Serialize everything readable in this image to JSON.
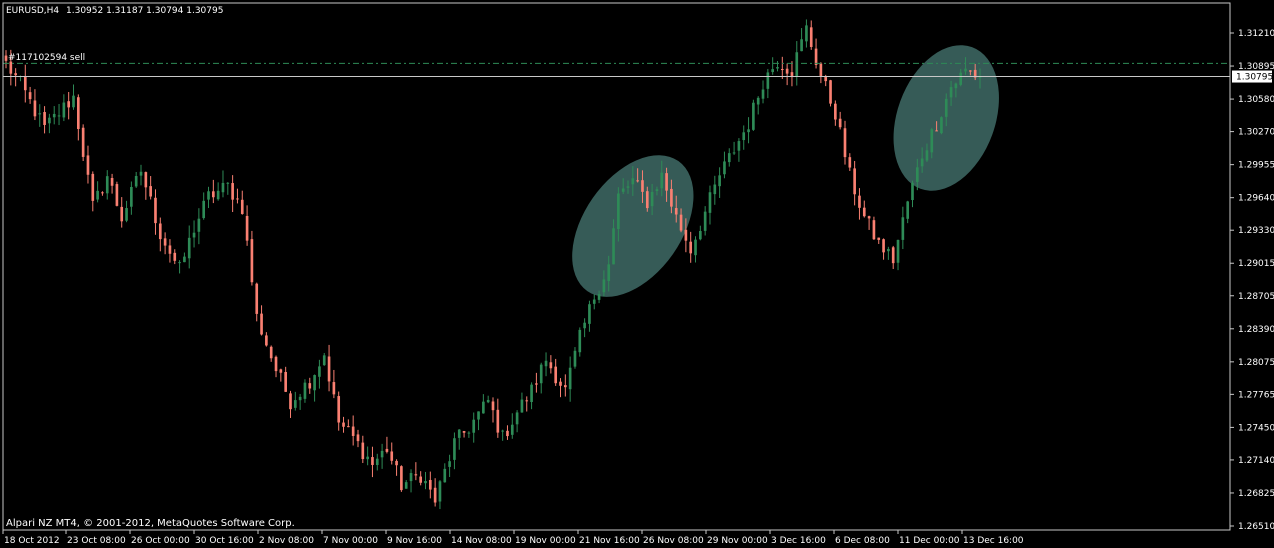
{
  "header": {
    "symbol": "EURUSD,H4",
    "ohlc": "1.30952 1.31187 1.30794 1.30795"
  },
  "order_label": "#117102594 sell",
  "copyright": "Alpari NZ MT4, © 2001-2012, MetaQuotes Software Corp.",
  "colors": {
    "background": "#000000",
    "bull": "#2e8b57",
    "bear": "#fa8072",
    "bid_line": "#c8c8c8",
    "order_line": "#2e8b57",
    "highlight": "#3f6b66"
  },
  "chart_data": {
    "type": "candlestick",
    "symbol": "EURUSD",
    "timeframe": "H4",
    "y_ticks": [
      "1.31210",
      "1.30895",
      "1.30580",
      "1.30270",
      "1.29955",
      "1.29640",
      "1.29330",
      "1.29015",
      "1.28705",
      "1.28390",
      "1.28075",
      "1.27765",
      "1.27450",
      "1.27140",
      "1.26825",
      "1.26510"
    ],
    "ylim": [
      1.2651,
      1.3121
    ],
    "x_ticks": [
      "18 Oct 2012",
      "23 Oct 08:00",
      "26 Oct 00:00",
      "30 Oct 16:00",
      "2 Nov 08:00",
      "7 Nov 00:00",
      "9 Nov 16:00",
      "14 Nov 08:00",
      "19 Nov 00:00",
      "21 Nov 16:00",
      "26 Nov 08:00",
      "29 Nov 00:00",
      "3 Dec 16:00",
      "6 Dec 08:00",
      "11 Dec 00:00",
      "13 Dec 16:00"
    ],
    "order_price": 1.3092,
    "current_bid": "1.30795",
    "current_bid_value": 1.30795,
    "highlighted_regions": [
      {
        "from_bar": 124,
        "to_bar": 136,
        "label": ""
      },
      {
        "from_bar": 189,
        "to_bar": 201,
        "label": ""
      }
    ],
    "close_path": [
      [
        0,
        1.3092
      ],
      [
        3,
        1.3072
      ],
      [
        8,
        1.303
      ],
      [
        14,
        1.306
      ],
      [
        18,
        1.2955
      ],
      [
        21,
        1.2985
      ],
      [
        24,
        1.2945
      ],
      [
        28,
        1.299
      ],
      [
        32,
        1.293
      ],
      [
        36,
        1.2895
      ],
      [
        39,
        1.2935
      ],
      [
        42,
        1.2965
      ],
      [
        46,
        1.2975
      ],
      [
        49,
        1.2955
      ],
      [
        52,
        1.285
      ],
      [
        56,
        1.28
      ],
      [
        59,
        1.277
      ],
      [
        63,
        1.279
      ],
      [
        66,
        1.2815
      ],
      [
        69,
        1.275
      ],
      [
        72,
        1.2735
      ],
      [
        76,
        1.271
      ],
      [
        79,
        1.2725
      ],
      [
        82,
        1.269
      ],
      [
        86,
        1.27
      ],
      [
        89,
        1.2675
      ],
      [
        93,
        1.273
      ],
      [
        96,
        1.2745
      ],
      [
        100,
        1.277
      ],
      [
        103,
        1.2735
      ],
      [
        106,
        1.276
      ],
      [
        109,
        1.278
      ],
      [
        112,
        1.281
      ],
      [
        116,
        1.278
      ],
      [
        119,
        1.283
      ],
      [
        122,
        1.287
      ],
      [
        125,
        1.29
      ],
      [
        127,
        1.2965
      ],
      [
        130,
        1.298
      ],
      [
        133,
        1.296
      ],
      [
        136,
        1.2985
      ],
      [
        139,
        1.2945
      ],
      [
        142,
        1.2915
      ],
      [
        145,
        1.295
      ],
      [
        148,
        1.2985
      ],
      [
        151,
        1.301
      ],
      [
        154,
        1.3035
      ],
      [
        157,
        1.3075
      ],
      [
        160,
        1.3095
      ],
      [
        163,
        1.3085
      ],
      [
        166,
        1.3125
      ],
      [
        169,
        1.308
      ],
      [
        172,
        1.3045
      ],
      [
        175,
        1.2985
      ],
      [
        178,
        1.2945
      ],
      [
        181,
        1.292
      ],
      [
        184,
        1.2905
      ],
      [
        187,
        1.296
      ],
      [
        190,
        1.3005
      ],
      [
        193,
        1.3035
      ],
      [
        196,
        1.307
      ],
      [
        199,
        1.3085
      ],
      [
        202,
        1.3079
      ]
    ],
    "bar_count": 203
  }
}
